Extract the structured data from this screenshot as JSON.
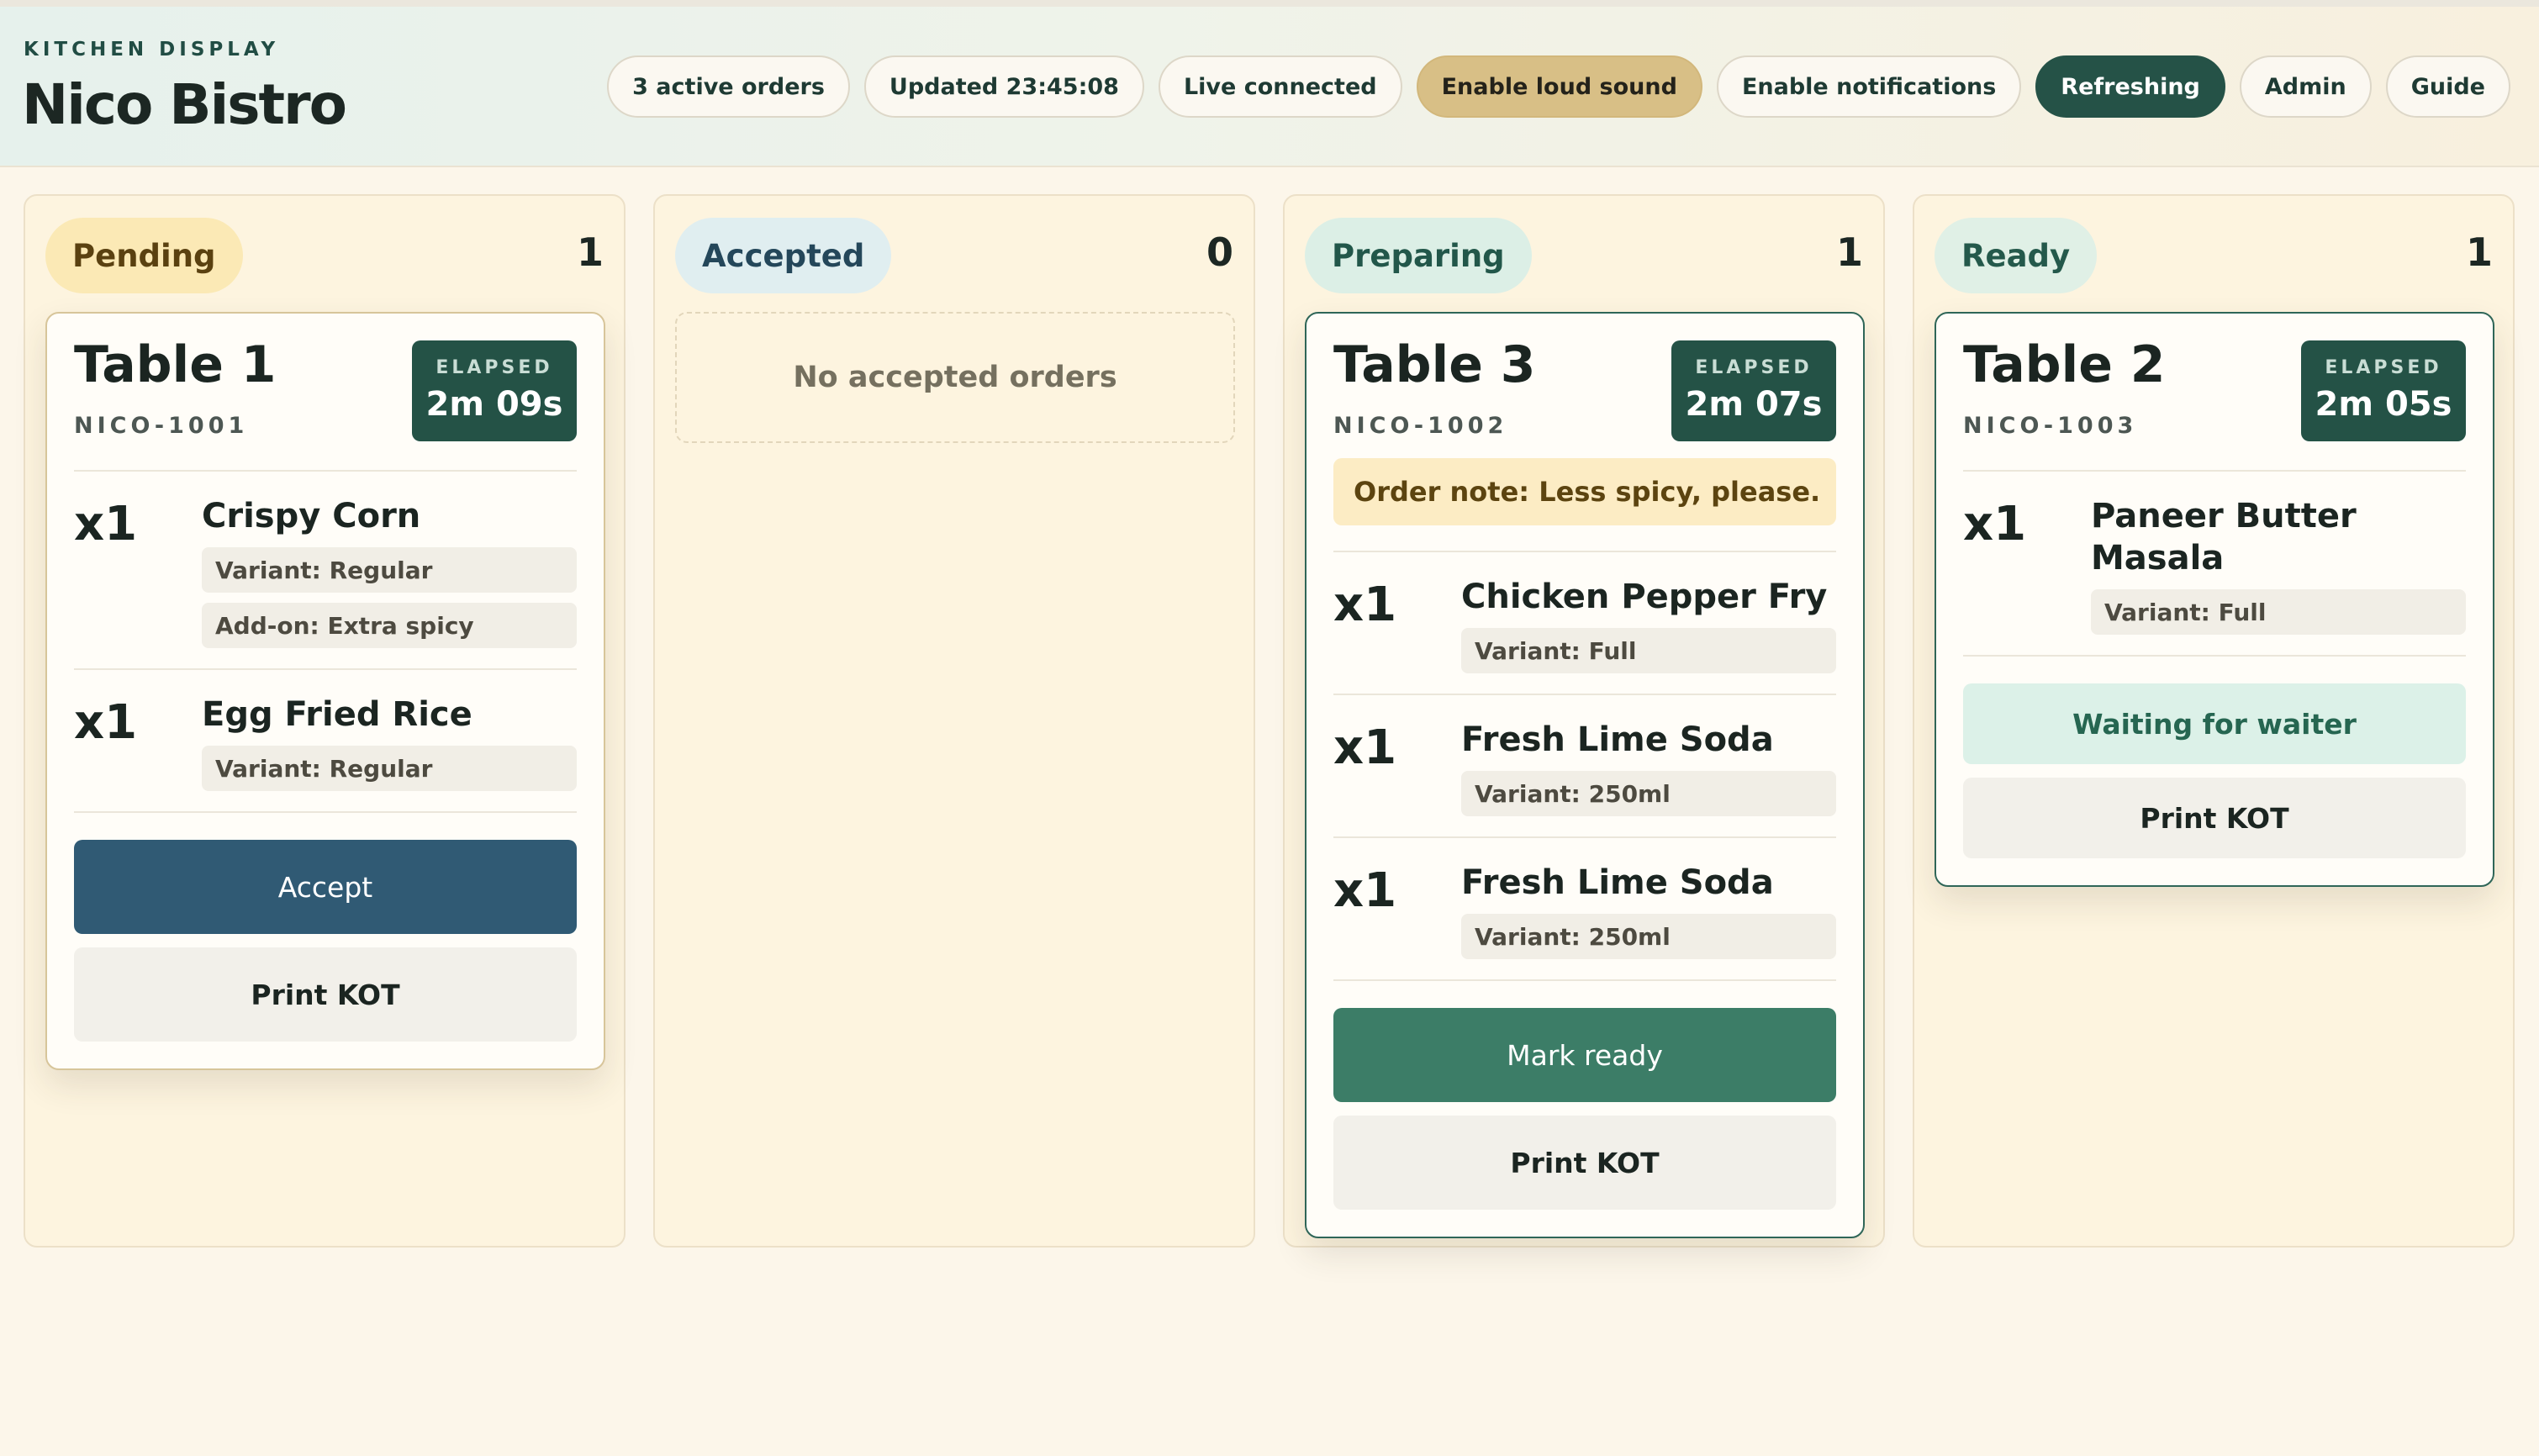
{
  "brand": {
    "kicker": "KITCHEN DISPLAY",
    "title": "Nico Bistro"
  },
  "header_chips": {
    "active_orders": "3 active orders",
    "updated": "Updated 23:45:08",
    "live": "Live connected",
    "loud_sound": "Enable loud sound",
    "notifications": "Enable notifications",
    "refreshing": "Refreshing",
    "admin": "Admin",
    "guide": "Guide"
  },
  "elapsed_label": "ELAPSED",
  "columns": {
    "pending": {
      "label": "Pending",
      "count": "1",
      "order": {
        "table": "Table 1",
        "code": "NICO-1001",
        "elapsed": "2m 09s",
        "items": [
          {
            "qty": "x1",
            "name": "Crispy Corn",
            "tags": [
              "Variant: Regular",
              "Add-on: Extra spicy"
            ]
          },
          {
            "qty": "x1",
            "name": "Egg Fried Rice",
            "tags": [
              "Variant: Regular"
            ]
          }
        ],
        "primary_action": "Accept",
        "print": "Print KOT"
      }
    },
    "accepted": {
      "label": "Accepted",
      "count": "0",
      "empty": "No accepted orders"
    },
    "preparing": {
      "label": "Preparing",
      "count": "1",
      "order": {
        "table": "Table 3",
        "code": "NICO-1002",
        "elapsed": "2m 07s",
        "note": "Order note: Less spicy, please.",
        "items": [
          {
            "qty": "x1",
            "name": "Chicken Pepper Fry",
            "tags": [
              "Variant: Full"
            ]
          },
          {
            "qty": "x1",
            "name": "Fresh Lime Soda",
            "tags": [
              "Variant: 250ml"
            ]
          },
          {
            "qty": "x1",
            "name": "Fresh Lime Soda",
            "tags": [
              "Variant: 250ml"
            ]
          }
        ],
        "primary_action": "Mark ready",
        "print": "Print KOT"
      }
    },
    "ready": {
      "label": "Ready",
      "count": "1",
      "order": {
        "table": "Table 2",
        "code": "NICO-1003",
        "elapsed": "2m 05s",
        "items": [
          {
            "qty": "x1",
            "name": "Paneer Butter Masala",
            "tags": [
              "Variant: Full"
            ]
          }
        ],
        "status": "Waiting for waiter",
        "print": "Print KOT"
      }
    }
  }
}
